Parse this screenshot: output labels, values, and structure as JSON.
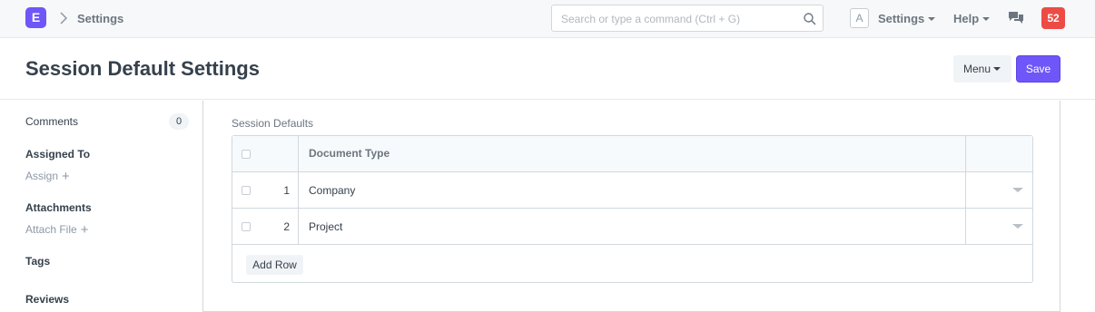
{
  "navbar": {
    "logo_letter": "E",
    "breadcrumb": "Settings",
    "search_placeholder": "Search or type a command (Ctrl + G)",
    "avatar_letter": "A",
    "settings_label": "Settings",
    "help_label": "Help",
    "notification_count": "52",
    "accent_color": "#6e56f8",
    "badge_color": "#ed4b45"
  },
  "page": {
    "title": "Session Default Settings",
    "menu_label": "Menu",
    "save_label": "Save"
  },
  "sidebar": {
    "comments_label": "Comments",
    "comments_count": "0",
    "assigned_to_label": "Assigned To",
    "assign_label": "Assign",
    "attachments_label": "Attachments",
    "attach_file_label": "Attach File",
    "tags_label": "Tags",
    "reviews_label": "Reviews"
  },
  "form": {
    "field_label": "Session Defaults",
    "columns": [
      "Document Type"
    ],
    "rows": [
      {
        "idx": "1",
        "document_type": "Company"
      },
      {
        "idx": "2",
        "document_type": "Project"
      }
    ],
    "add_row_label": "Add Row"
  }
}
